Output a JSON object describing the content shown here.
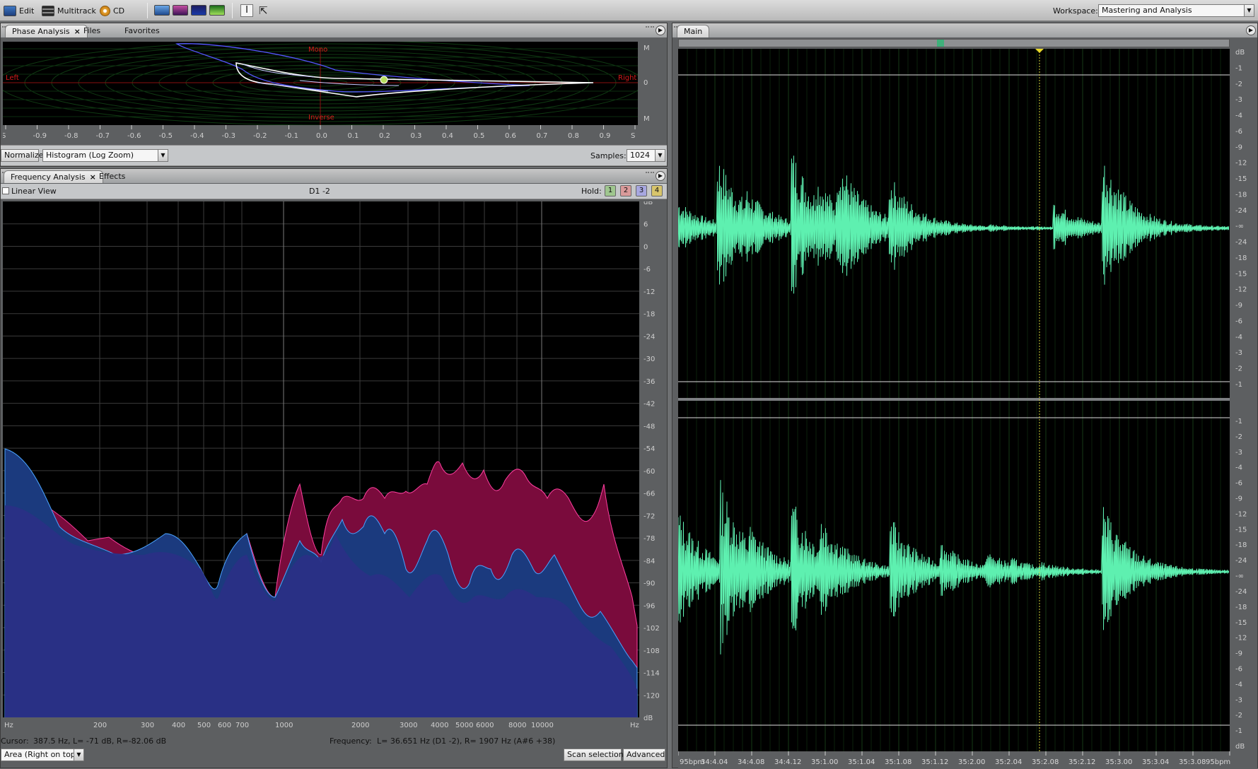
{
  "toolbar": {
    "edit_label": "Edit",
    "multitrack_label": "Multitrack",
    "cd_label": "CD",
    "workspace_label": "Workspace:",
    "workspace_value": "Mastering and Analysis"
  },
  "phase_panel": {
    "tabs": [
      {
        "label": "Phase Analysis",
        "active": true
      },
      {
        "label": "Files",
        "active": false
      },
      {
        "label": "Favorites",
        "active": false
      }
    ],
    "labels": {
      "mono": "Mono",
      "left": "Left",
      "right": "Right",
      "inverse": "Inverse"
    },
    "right_scale": [
      "M",
      "0",
      "M"
    ],
    "x_ticks": [
      "S",
      "-0.9",
      "-0.8",
      "-0.7",
      "-0.6",
      "-0.5",
      "-0.4",
      "-0.3",
      "-0.2",
      "-0.1",
      "0.0",
      "0.1",
      "0.2",
      "0.3",
      "0.4",
      "0.5",
      "0.6",
      "0.7",
      "0.8",
      "0.9",
      "S"
    ],
    "normalize_label": "Normalize",
    "mode_value": "Histogram (Log Zoom)",
    "samples_label": "Samples:",
    "samples_value": "1024"
  },
  "freq_panel": {
    "tabs": [
      {
        "label": "Frequency Analysis",
        "active": true
      },
      {
        "label": "Effects",
        "active": false
      }
    ],
    "linear_view_label": "Linear View",
    "linear_view_checked": false,
    "channel_label": "D1 -2",
    "hold_label": "Hold:",
    "hold_buttons": [
      {
        "label": "1",
        "color": "#9fc68f"
      },
      {
        "label": "2",
        "color": "#d99a9a"
      },
      {
        "label": "3",
        "color": "#a7a7e0"
      },
      {
        "label": "4",
        "color": "#d8c56c"
      }
    ],
    "db_scale": [
      "dB",
      "6",
      "0",
      "-6",
      "-12",
      "-18",
      "-24",
      "-30",
      "-36",
      "-42",
      "-48",
      "-54",
      "-60",
      "-66",
      "-72",
      "-78",
      "-84",
      "-90",
      "-96",
      "-102",
      "-108",
      "-114",
      "-120",
      "dB"
    ],
    "hz_ticks": [
      "Hz",
      "200",
      "300",
      "400",
      "500",
      "600",
      "700",
      "1000",
      "2000",
      "3000",
      "4000",
      "5000",
      "6000",
      "8000",
      "10000",
      "Hz"
    ],
    "cursor_label": "Cursor:",
    "cursor_value": "387.5 Hz, L=   -71 dB, R=-82.06 dB",
    "frequency_label": "Frequency:",
    "frequency_value": "L= 36.651 Hz (D1 -2), R=   1907 Hz (A#6 +38)",
    "display_mode_value": "Area (Right on top)",
    "scan_button": "Scan selection",
    "advanced_button": "Advanced",
    "colors": {
      "left_fill": "#1b3a7e",
      "right_fill": "#7a0b3c",
      "overlap_fill": "#2a2f86",
      "left_line": "#4aa3ff",
      "right_line": "#ff3fa0"
    }
  },
  "main_panel": {
    "tab_label": "Main",
    "db_scale_top": [
      "dB",
      "-1",
      "-2",
      "-3",
      "-4",
      "-6",
      "-9",
      "-12",
      "-15",
      "-18",
      "-24",
      "-∞",
      "-24",
      "-18",
      "-15",
      "-12",
      "-9",
      "-6",
      "-4",
      "-3",
      "-2",
      "-1"
    ],
    "db_scale_bottom": [
      "-1",
      "-2",
      "-3",
      "-4",
      "-6",
      "-9",
      "-12",
      "-15",
      "-18",
      "-24",
      "-∞",
      "-24",
      "-18",
      "-15",
      "-12",
      "-9",
      "-6",
      "-4",
      "-3",
      "-2",
      "-1",
      "dB"
    ],
    "time_ticks": [
      "95bpm",
      "34:4.04",
      "34:4.08",
      "34:4.12",
      "35:1.00",
      "35:1.04",
      "35:1.08",
      "35:1.12",
      "35:2.00",
      "35:2.04",
      "35:2.08",
      "35:2.12",
      "35:3.00",
      "35:3.04",
      "35:3.08",
      "95bpm"
    ],
    "colors": {
      "waveform": "#5ef0b0",
      "cursor": "#d8d83a"
    }
  }
}
